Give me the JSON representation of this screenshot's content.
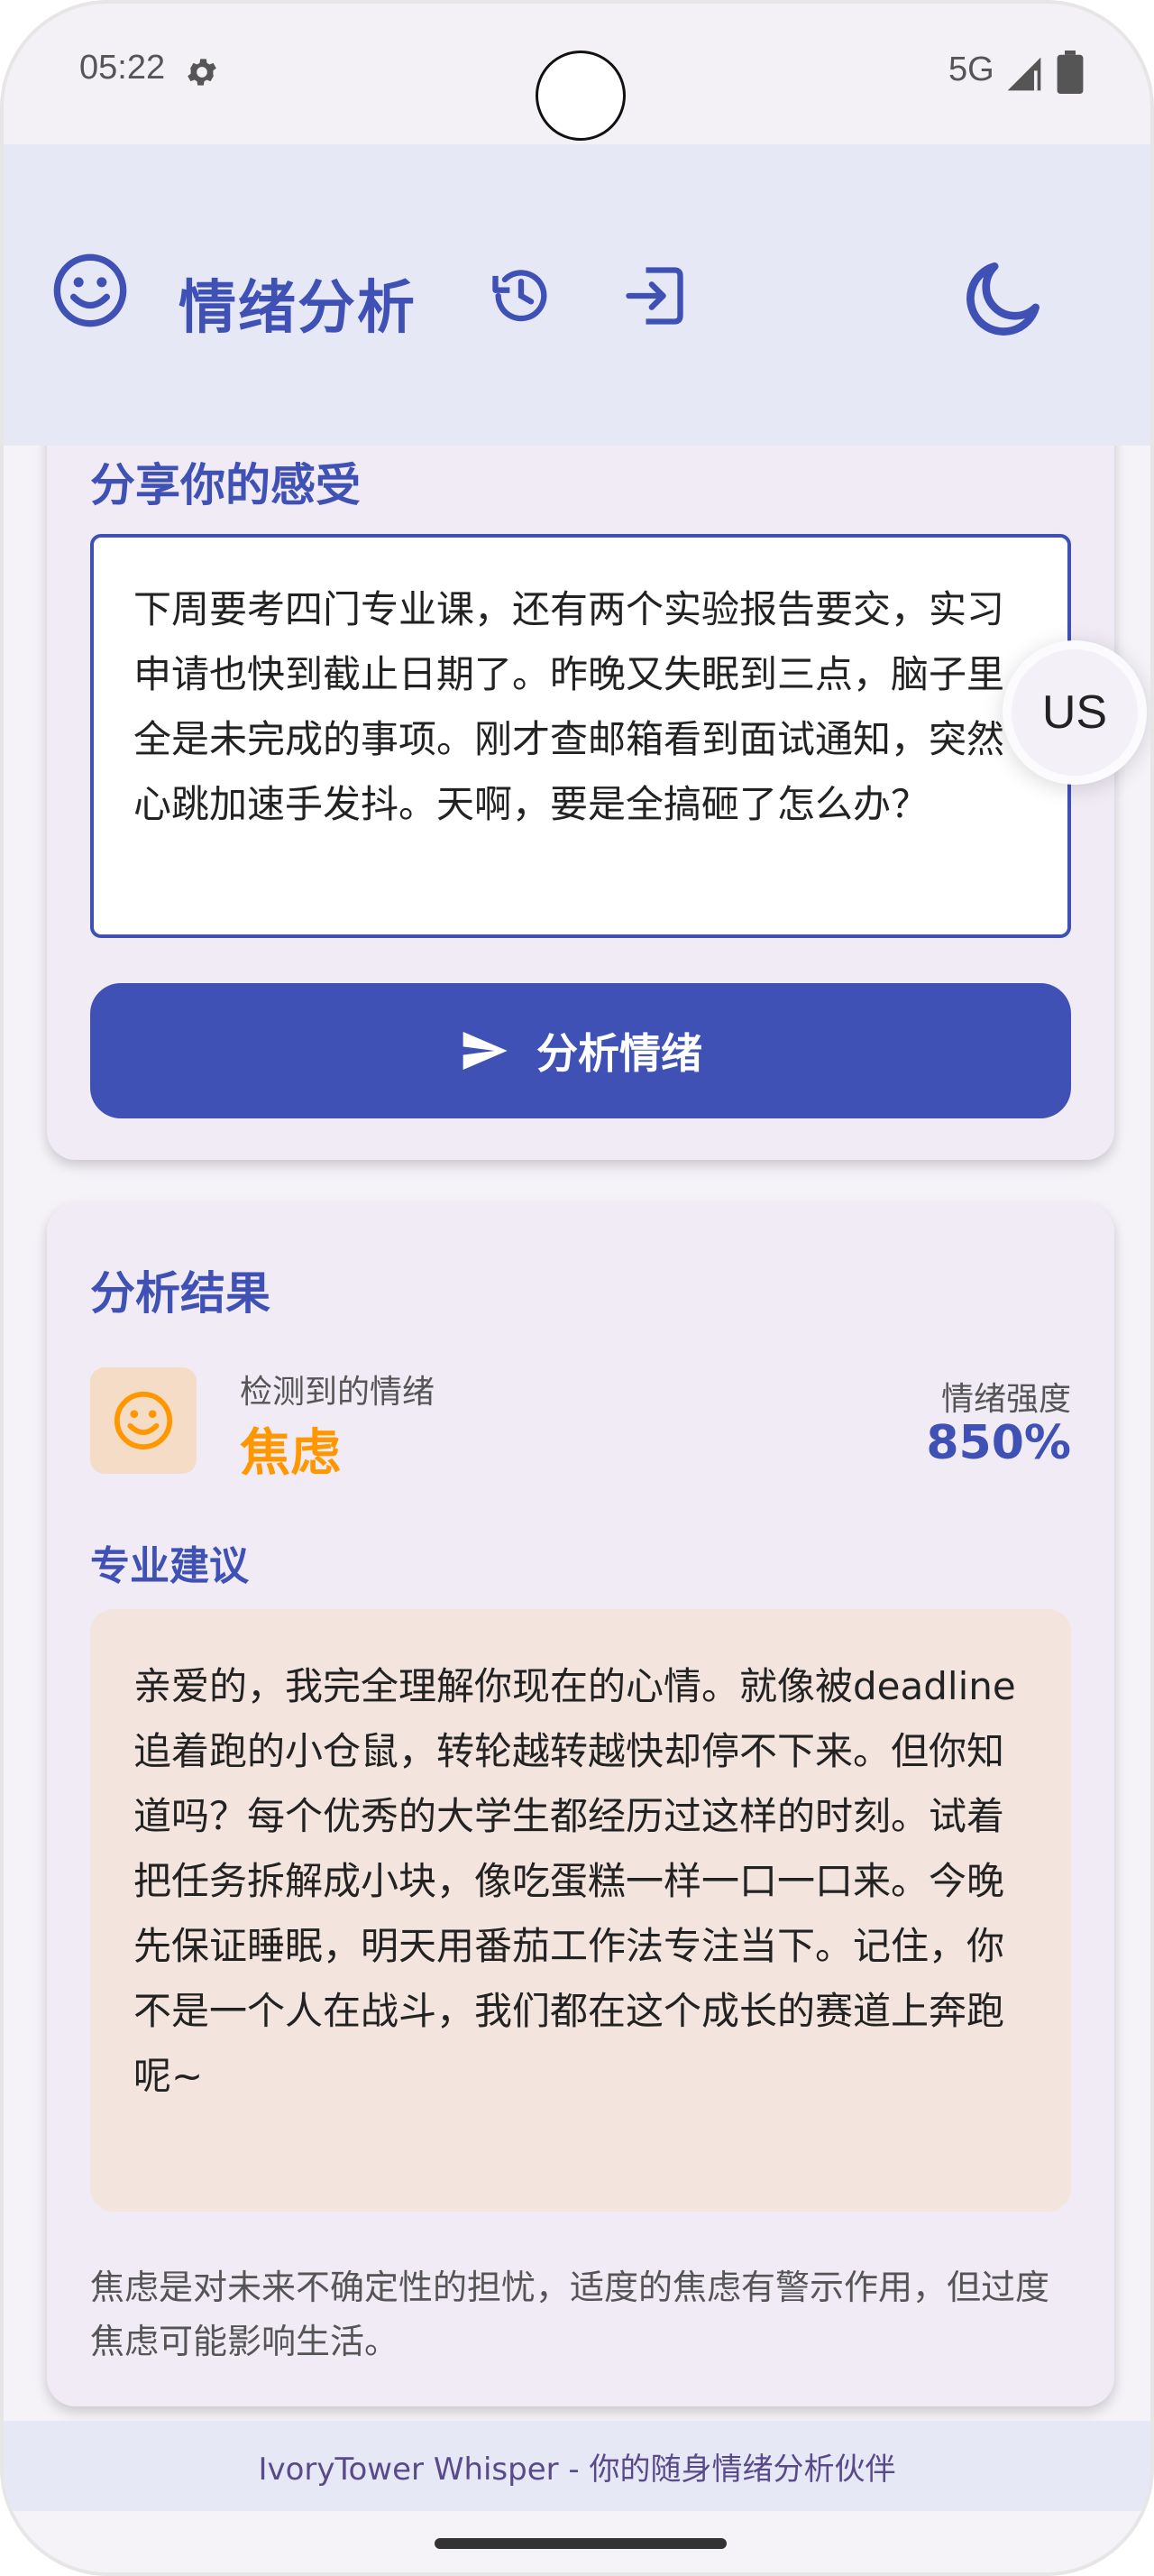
{
  "status_bar": {
    "time": "05:22",
    "network": "5G",
    "icons": [
      "gear-icon",
      "signal-icon",
      "battery-icon"
    ]
  },
  "app_bar": {
    "title": "情绪分析",
    "icons": [
      "smiley-logo-icon",
      "history-icon",
      "logout-icon",
      "moon-icon"
    ]
  },
  "input_card": {
    "title": "分享你的感受",
    "text_value": "下周要考四门专业课，还有两个实验报告要交，实习申请也快到截止日期了。昨晚又失眠到三点，脑子里全是未完成的事项。刚才查邮箱看到面试通知，突然心跳加速手发抖。天啊，要是全搞砸了怎么办？",
    "analyze_button": "分析情绪"
  },
  "result_card": {
    "title": "分析结果",
    "detected_label": "检测到的情绪",
    "emotion": "焦虑",
    "intensity_label": "情绪强度",
    "intensity_value": "850%",
    "advice_title": "专业建议",
    "advice_text": "亲爱的，我完全理解你现在的心情。就像被deadline追着跑的小仓鼠，转轮越转越快却停不下来。但你知道吗？每个优秀的大学生都经历过这样的时刻。试着把任务拆解成小块，像吃蛋糕一样一口一口来。今晚先保证睡眠，明天用番茄工作法专注当下。记住，你不是一个人在战斗，我们都在这个成长的赛道上奔跑呢~",
    "description": "焦虑是对未来不确定性的担忧，适度的焦虑有警示作用，但过度焦虑可能影响生活。"
  },
  "avatar": {
    "initials": "US"
  },
  "footer": {
    "text": "IvoryTower Whisper - 你的随身情绪分析伙伴"
  },
  "colors": {
    "primary": "#3f51b5",
    "emotion_accent": "#ff9800",
    "card_bg": "#f0ebf5",
    "advice_bg": "#f3e4dd",
    "app_bar_bg": "#e6e8f6"
  }
}
